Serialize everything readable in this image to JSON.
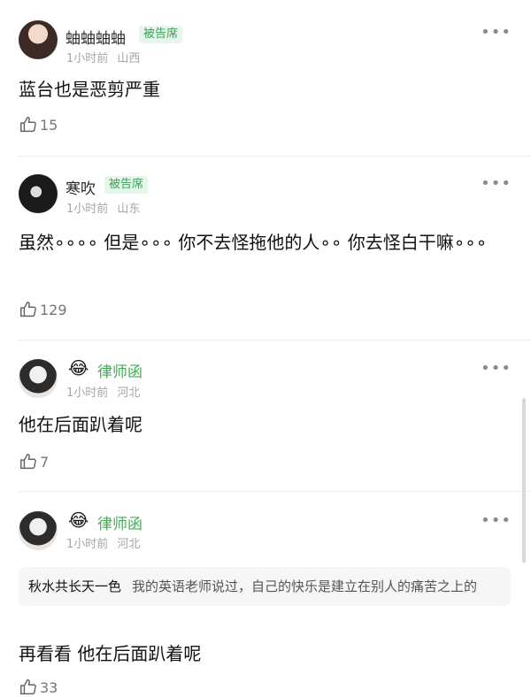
{
  "comments": [
    {
      "name": "蚰蚰蚰蚰",
      "badge": "被告席",
      "time": "1小时前",
      "location": "山西",
      "text": "蓝台也是恶剪严重",
      "likes": "15"
    },
    {
      "name": "寒吹",
      "badge": "被告席",
      "time": "1小时前",
      "location": "山东",
      "text": "虽然∘∘∘∘ 但是∘∘∘ 你不去怪拖他的人∘∘ 你去怪白干嘛∘∘∘",
      "likes": "129"
    },
    {
      "emoji": "😂",
      "name": "律师函",
      "time": "1小时前",
      "location": "河北",
      "text": "他在后面趴着呢",
      "likes": "7"
    },
    {
      "emoji": "😂",
      "name": "律师函",
      "time": "1小时前",
      "location": "河北",
      "quote_name": "秋水共长天一色",
      "quote_text": "我的英语老师说过，自己的快乐是建立在别人的痛苦之上的",
      "text": "再看看 他在后面趴着呢",
      "likes": "33"
    }
  ],
  "more_label": "•••",
  "icons": {
    "like": "thumb-up-icon",
    "more": "more-icon"
  }
}
